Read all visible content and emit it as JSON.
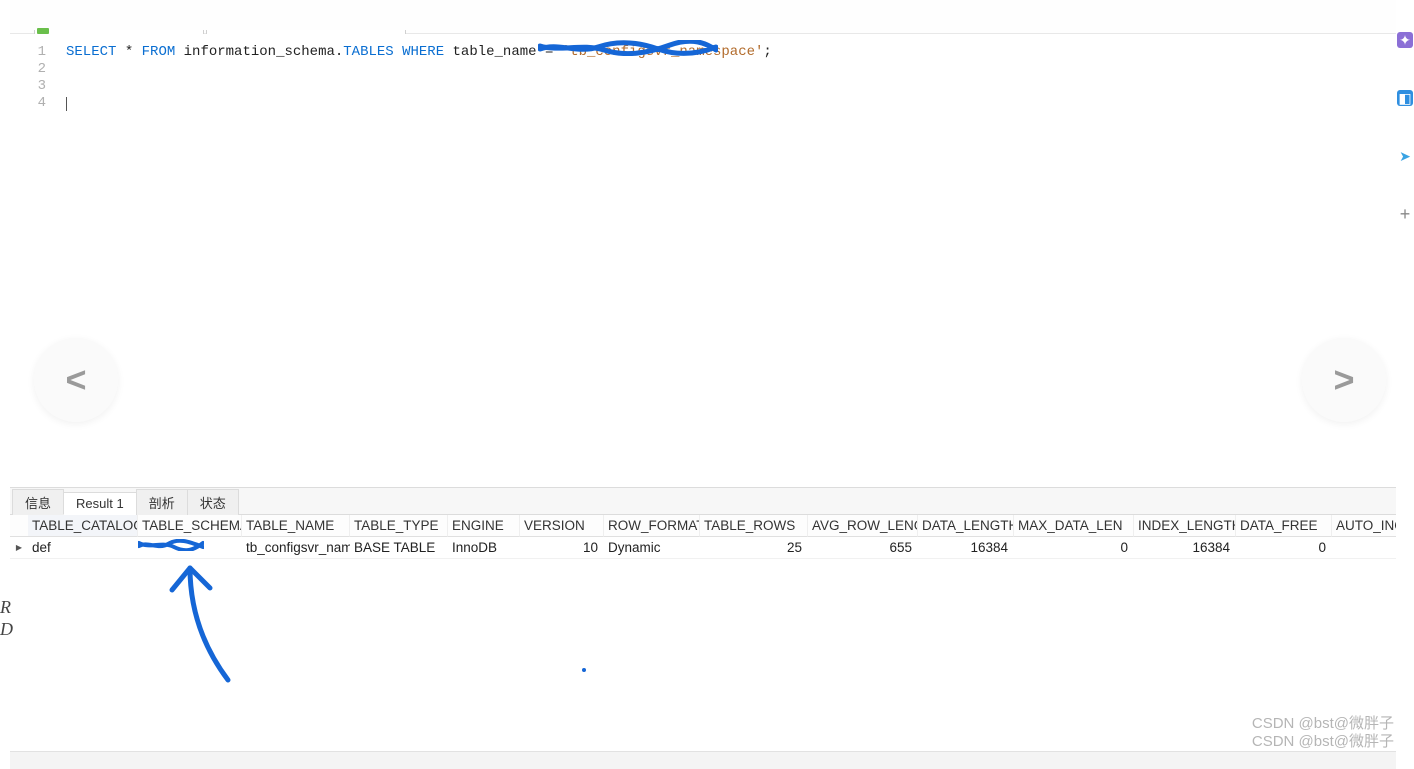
{
  "editor": {
    "lines": [
      "1",
      "2",
      "3",
      "4"
    ],
    "sql": {
      "kw_select": "SELECT",
      "star": " * ",
      "kw_from": "FROM",
      "schema": " information_schema.",
      "tables_kw": "TABLES",
      "kw_where": " WHERE",
      "col": " table_name ",
      "eq": "= ",
      "str_open": "'",
      "str_value": "tb_configsvr_namespace",
      "str_close": "'",
      "semicolon": ";"
    }
  },
  "nav": {
    "prev": "<",
    "next": ">"
  },
  "result_tabs": {
    "info": "信息",
    "result1": "Result 1",
    "profile": "剖析",
    "status": "状态"
  },
  "grid": {
    "headers": {
      "table_catalog": "TABLE_CATALOG",
      "table_schema": "TABLE_SCHEMA",
      "table_name": "TABLE_NAME",
      "table_type": "TABLE_TYPE",
      "engine": "ENGINE",
      "version": "VERSION",
      "row_format": "ROW_FORMAT",
      "table_rows": "TABLE_ROWS",
      "avg_row_length": "AVG_ROW_LENG",
      "data_length": "DATA_LENGTH",
      "max_data_length": "MAX_DATA_LEN",
      "index_length": "INDEX_LENGTH",
      "data_free": "DATA_FREE",
      "auto_increment": "AUTO_INC"
    },
    "row": {
      "table_catalog": "def",
      "table_schema": "(redacted)",
      "table_name": "tb_configsvr_nam",
      "table_type": "BASE TABLE",
      "engine": "InnoDB",
      "version": "10",
      "row_format": "Dynamic",
      "table_rows": "25",
      "avg_row_length": "655",
      "data_length": "16384",
      "max_data_length": "0",
      "index_length": "16384",
      "data_free": "0",
      "auto_increment": ""
    }
  },
  "watermark": {
    "line1": "CSDN @bst@微胖子",
    "line2": "CSDN @bst@微胖子"
  },
  "cropped_left": {
    "l1": "R",
    "l2": "D"
  },
  "side": {
    "a": "chat-icon",
    "b": "cloud-icon",
    "c": "send-icon",
    "d": "plus-icon"
  }
}
